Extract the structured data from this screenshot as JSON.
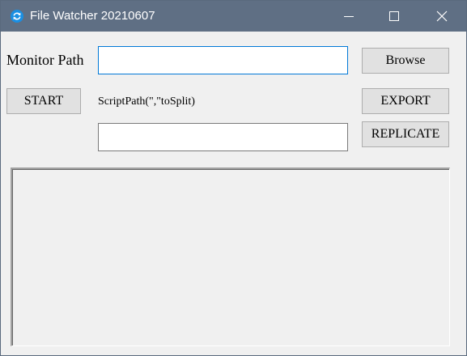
{
  "window": {
    "title": "File Watcher 20210607",
    "app_icon": "refresh-icon",
    "controls": {
      "minimize_icon": "minimize-icon",
      "maximize_icon": "maximize-icon",
      "close_icon": "close-icon"
    }
  },
  "form": {
    "monitor_path_label": "Monitor Path",
    "monitor_path_value": "",
    "browse_label": "Browse",
    "start_label": "START",
    "script_label": "ScriptPath(\",\"toSplit)",
    "export_label": "EXPORT",
    "script_value": "",
    "replicate_label": "REPLICATE"
  },
  "output": {
    "content": ""
  },
  "colors": {
    "titlebar": "#5f6f84",
    "window_bg": "#f0f0f0",
    "button_bg": "#e1e1e1",
    "focus_border": "#0078d7",
    "icon_blue": "#1a8fe3"
  }
}
